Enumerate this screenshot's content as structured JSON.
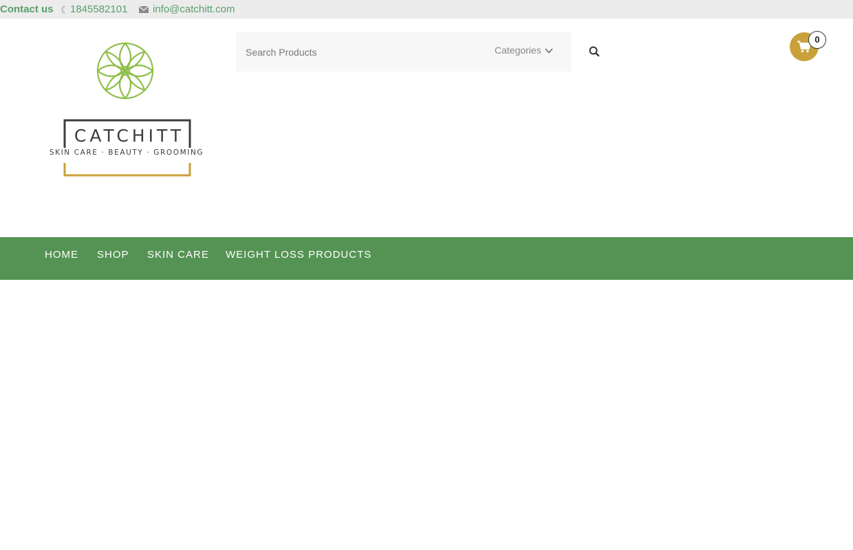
{
  "topbar": {
    "contact_label": "Contact us",
    "phone": "1845582101",
    "email": "info@catchitt.com",
    "text_color": "#5b9e6a"
  },
  "logo": {
    "wordmark": "CATCHITT",
    "tagline": "SKIN CARE · BEAUTY · GROOMING",
    "leaf_color": "#8fbf4a",
    "frame_color": "#c8a13a"
  },
  "search": {
    "placeholder": "Search Products",
    "categories_label": "Categories"
  },
  "cart": {
    "count": "0",
    "color": "#c8a13a"
  },
  "nav": {
    "background": "#559354",
    "items": [
      "HOME",
      "SHOP",
      "SKIN CARE",
      "WEIGHT LOSS PRODUCTS"
    ]
  },
  "icons": [
    "phone-icon",
    "mail-icon",
    "chevron-down-icon",
    "search-icon",
    "cart-icon"
  ]
}
